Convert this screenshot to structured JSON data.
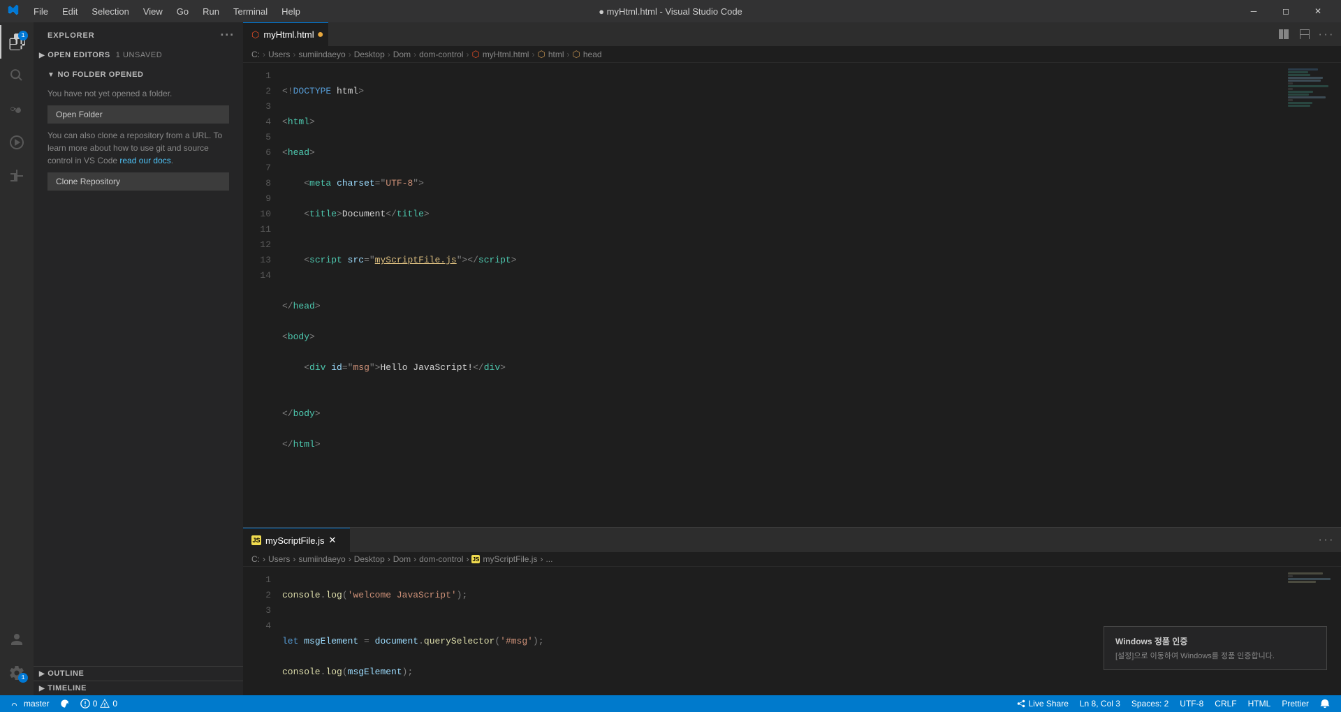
{
  "titleBar": {
    "logo": "⬡",
    "menu": [
      "File",
      "Edit",
      "Selection",
      "View",
      "Go",
      "Run",
      "Terminal",
      "Help"
    ],
    "title": "● myHtml.html - Visual Studio Code",
    "controls": [
      "—",
      "❐",
      "✕"
    ]
  },
  "activityBar": {
    "icons": [
      {
        "name": "explorer-icon",
        "symbol": "⊞",
        "active": true,
        "badge": "1"
      },
      {
        "name": "search-icon",
        "symbol": "🔍",
        "active": false
      },
      {
        "name": "source-control-icon",
        "symbol": "⑂",
        "active": false
      },
      {
        "name": "run-debug-icon",
        "symbol": "▷",
        "active": false
      },
      {
        "name": "extensions-icon",
        "symbol": "⊟",
        "active": false
      }
    ],
    "bottomIcons": [
      {
        "name": "account-icon",
        "symbol": "👤"
      },
      {
        "name": "settings-icon",
        "symbol": "⚙",
        "badge": "1"
      }
    ]
  },
  "sidebar": {
    "title": "EXPLORER",
    "openEditors": {
      "label": "OPEN EDITORS",
      "unsaved": "1 UNSAVED"
    },
    "noFolder": {
      "title": "NO FOLDER OPENED",
      "description": "You have not yet opened a folder.",
      "openFolderBtn": "Open Folder",
      "cloneText": "You can also clone a repository from a URL. To learn more about how to use git and source control in VS Code ",
      "linkText": "read our docs",
      "cloneBtn": "Clone Repository"
    },
    "outline": "OUTLINE",
    "timeline": "TIMELINE"
  },
  "editor": {
    "tab": {
      "label": "myHtml.html",
      "icon": "html",
      "unsaved": true
    },
    "breadcrumb": [
      "C:",
      "Users",
      "sumiindaeyo",
      "Desktop",
      "Dom",
      "dom-control",
      "myHtml.html",
      "html",
      "head"
    ],
    "lines": [
      {
        "num": 1,
        "content": "&lt;!DOCTYPE html&gt;"
      },
      {
        "num": 2,
        "content": "&lt;html&gt;"
      },
      {
        "num": 3,
        "content": "&lt;head&gt;"
      },
      {
        "num": 4,
        "content": "    &lt;meta charset=\"UTF-8\"&gt;"
      },
      {
        "num": 5,
        "content": "    &lt;title&gt;Document&lt;/title&gt;"
      },
      {
        "num": 6,
        "content": ""
      },
      {
        "num": 7,
        "content": "    &lt;script src=\"myScriptFile.js\"&gt;&lt;/script&gt;"
      },
      {
        "num": 8,
        "content": ""
      },
      {
        "num": 9,
        "content": "&lt;/head&gt;"
      },
      {
        "num": 10,
        "content": "&lt;body&gt;"
      },
      {
        "num": 11,
        "content": "    &lt;div id=\"msg\"&gt;Hello JavaScript!&lt;/div&gt;"
      },
      {
        "num": 12,
        "content": ""
      },
      {
        "num": 13,
        "content": "&lt;/body&gt;"
      },
      {
        "num": 14,
        "content": "&lt;/html&gt;"
      }
    ]
  },
  "scriptEditor": {
    "tab": {
      "label": "myScriptFile.js",
      "icon": "js",
      "active": true
    },
    "breadcrumb": [
      "C:",
      "Users",
      "sumiindaeyo",
      "Desktop",
      "Dom",
      "dom-control",
      "myScriptFile.js",
      "..."
    ],
    "lines": [
      {
        "num": 1,
        "content": "console.log('welcome JavaScript');"
      },
      {
        "num": 2,
        "content": ""
      },
      {
        "num": 3,
        "content": "let msgElement = document.querySelector('#msg');"
      },
      {
        "num": 4,
        "content": "console.log(msgElement);"
      }
    ]
  },
  "statusBar": {
    "left": [
      {
        "label": "⎇ master"
      },
      {
        "label": "↺"
      },
      {
        "label": "⊗ 0  ⚠ 0"
      }
    ],
    "right": [
      {
        "label": "Live Share"
      },
      {
        "label": "Ln 8, Col 3"
      },
      {
        "label": "Spaces: 2"
      },
      {
        "label": "UTF-8"
      },
      {
        "label": "CRLF"
      },
      {
        "label": "HTML"
      },
      {
        "label": "Prettier"
      },
      {
        "label": "🔔"
      }
    ]
  },
  "authPopup": {
    "title": "Windows 정품 인증",
    "text": "[설정]으로 이동하여 Windows를 정품 인증합니다."
  }
}
